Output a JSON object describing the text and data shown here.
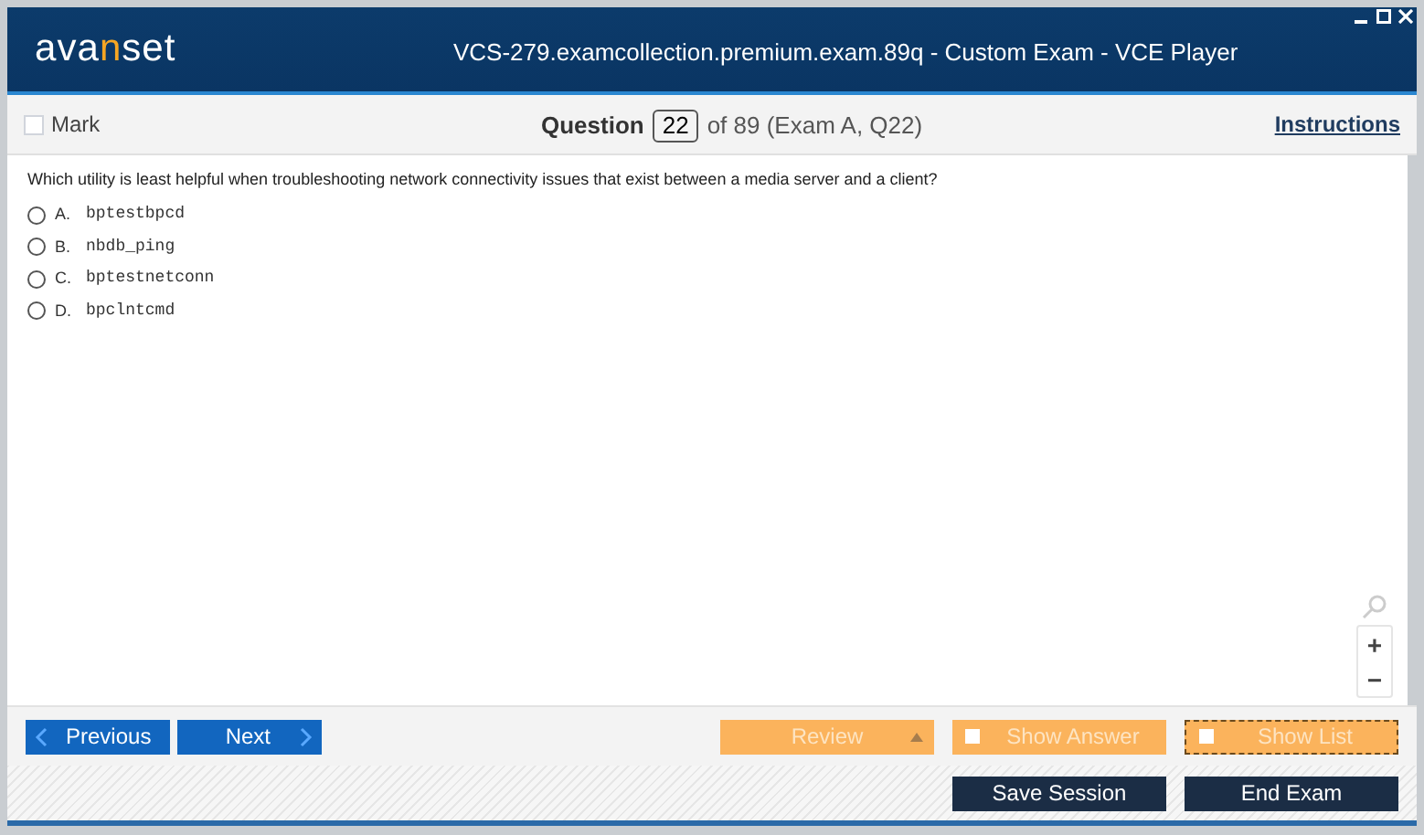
{
  "window": {
    "title": "VCS-279.examcollection.premium.exam.89q - Custom Exam - VCE Player",
    "logo": [
      {
        "text": "ava",
        "accent": false
      },
      {
        "text": "n",
        "accent": true
      },
      {
        "text": "set",
        "accent": false
      }
    ]
  },
  "toolbar": {
    "mark": {
      "label": "Mark",
      "checked": false
    },
    "question_label": "Question",
    "question_number": "22",
    "question_of": "of 89 (Exam A, Q22)",
    "instructions": "Instructions"
  },
  "question": {
    "text": "Which utility is least helpful when troubleshooting network connectivity issues that exist between a media server and a client?",
    "options": [
      {
        "letter": "A.",
        "text": "bptestbpcd",
        "selected": false
      },
      {
        "letter": "B.",
        "text": "nbdb_ping",
        "selected": false
      },
      {
        "letter": "C.",
        "text": "bptestnetconn",
        "selected": false
      },
      {
        "letter": "D.",
        "text": "bpclntcmd",
        "selected": false
      }
    ]
  },
  "zoom": {
    "in": "+",
    "out": "−"
  },
  "nav": {
    "previous": "Previous",
    "next": "Next",
    "review": "Review",
    "toggles": [
      {
        "label": "Show Answer",
        "checked": false,
        "focused": false
      },
      {
        "label": "Show List",
        "checked": false,
        "focused": true
      }
    ]
  },
  "footer": {
    "buttons": [
      "Save Session",
      "End Exam"
    ]
  }
}
